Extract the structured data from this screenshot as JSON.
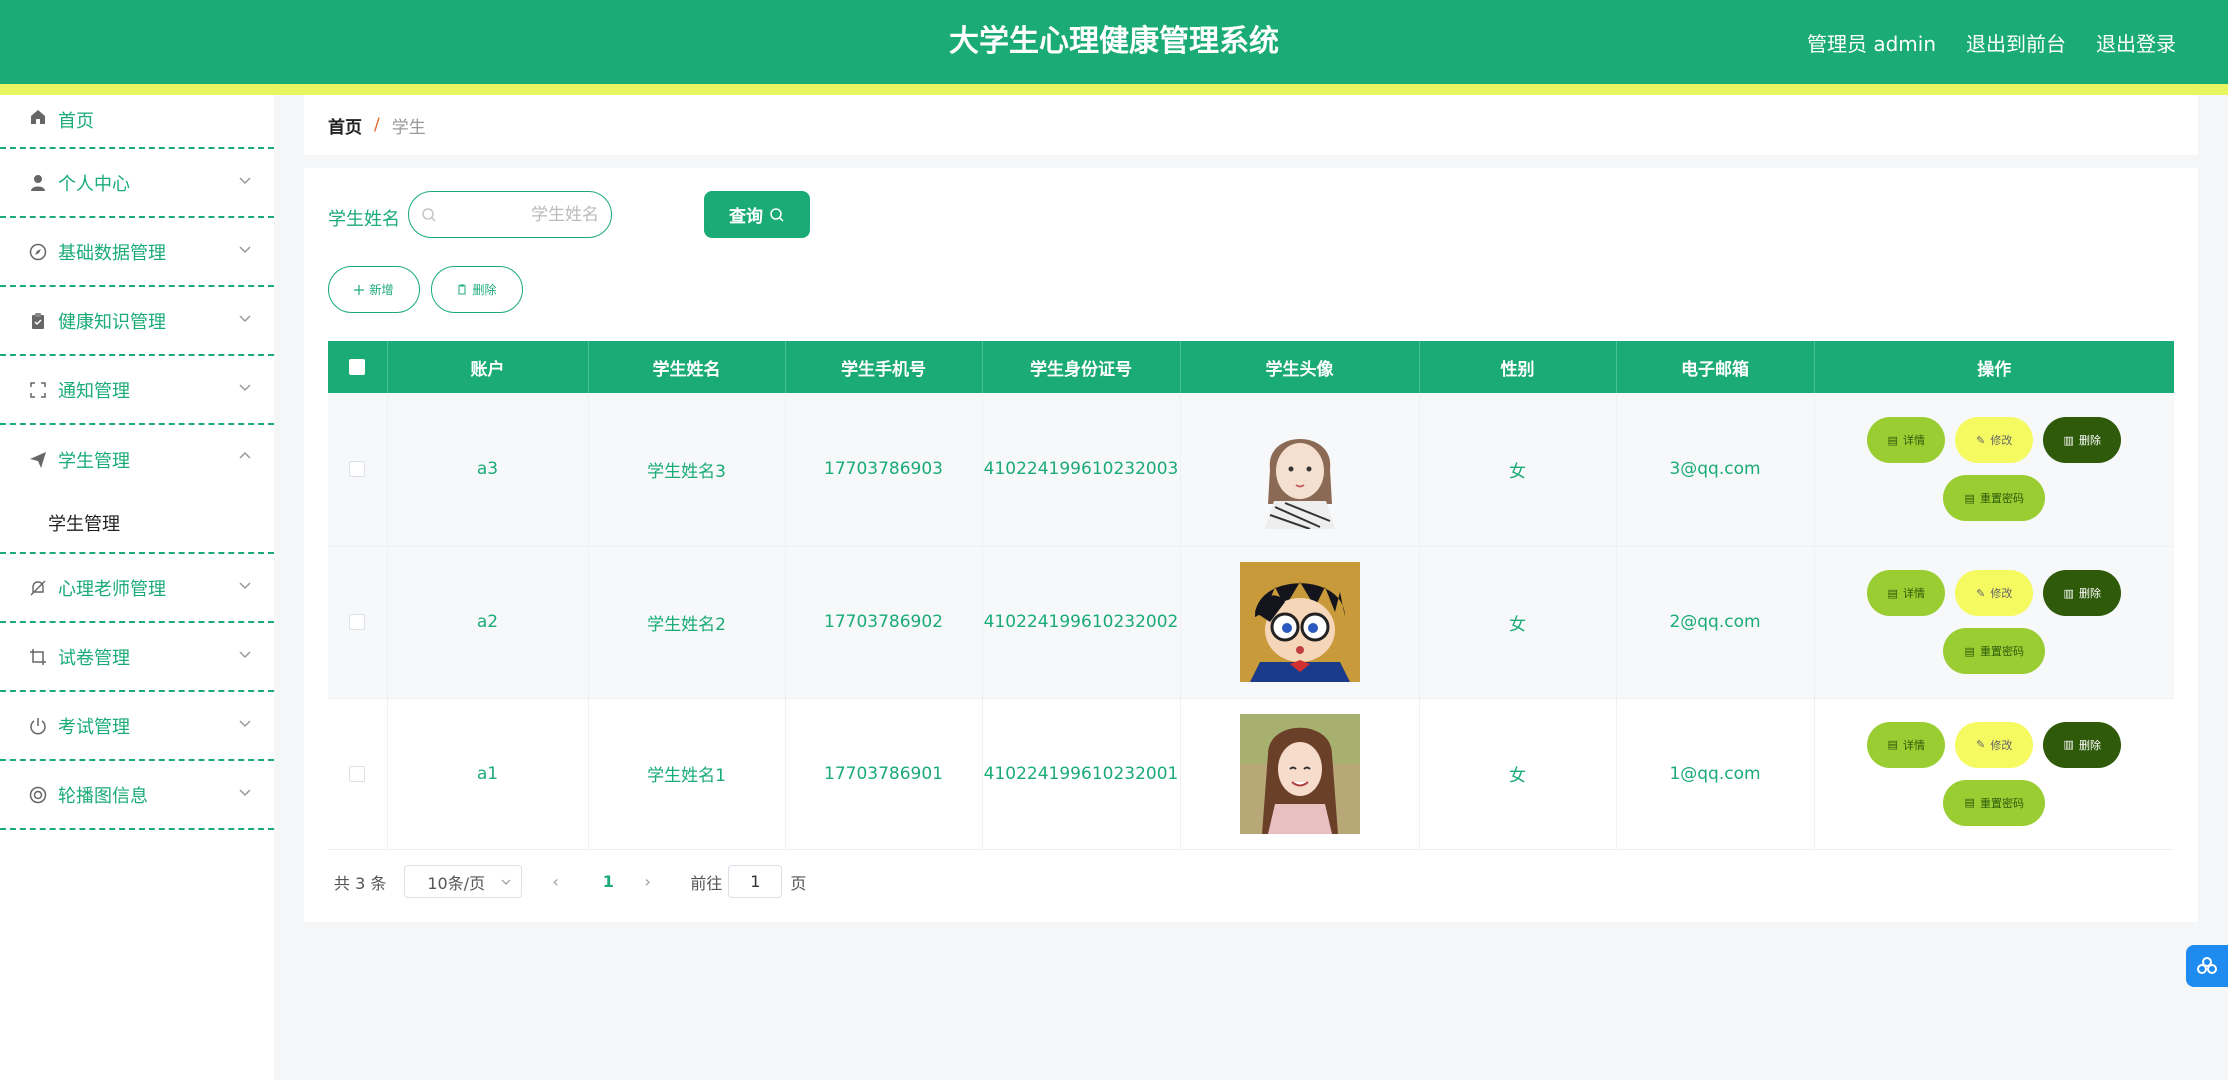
{
  "header": {
    "title": "大学生心理健康管理系统",
    "admin": "管理员 admin",
    "to_front": "退出到前台",
    "logout": "退出登录"
  },
  "sidebar": {
    "items": [
      {
        "label": "首页",
        "icon": "home-icon"
      },
      {
        "label": "个人中心",
        "icon": "user-icon"
      },
      {
        "label": "基础数据管理",
        "icon": "compass-icon"
      },
      {
        "label": "健康知识管理",
        "icon": "clipboard-icon"
      },
      {
        "label": "通知管理",
        "icon": "frame-icon"
      },
      {
        "label": "学生管理",
        "icon": "send-icon"
      },
      {
        "label": "心理老师管理",
        "icon": "bell-off-icon"
      },
      {
        "label": "试卷管理",
        "icon": "crop-icon"
      },
      {
        "label": "考试管理",
        "icon": "power-icon"
      },
      {
        "label": "轮播图信息",
        "icon": "lifebuoy-icon"
      }
    ],
    "sub_item": "学生管理"
  },
  "breadcrumb": {
    "home": "首页",
    "sep": "/",
    "current": "学生"
  },
  "search": {
    "label": "学生姓名",
    "placeholder": "学生姓名",
    "button": "查询"
  },
  "actions": {
    "add": "新增",
    "delete": "删除"
  },
  "table": {
    "headers": [
      "账户",
      "学生姓名",
      "学生手机号",
      "学生身份证号",
      "学生头像",
      "性别",
      "电子邮箱",
      "操作"
    ],
    "rows": [
      {
        "account": "a3",
        "name": "学生姓名3",
        "phone": "17703786903",
        "id_card": "410224199610232003",
        "gender": "女",
        "email": "3@qq.com"
      },
      {
        "account": "a2",
        "name": "学生姓名2",
        "phone": "17703786902",
        "id_card": "410224199610232002",
        "gender": "女",
        "email": "2@qq.com"
      },
      {
        "account": "a1",
        "name": "学生姓名1",
        "phone": "17703786901",
        "id_card": "410224199610232001",
        "gender": "女",
        "email": "1@qq.com"
      }
    ],
    "ops": {
      "detail": "详情",
      "edit": "修改",
      "delete": "删除",
      "reset": "重置密码"
    }
  },
  "pager": {
    "total": "共 3 条",
    "size": "10条/页",
    "current": "1",
    "goto": "前往",
    "page_value": "1",
    "unit": "页"
  },
  "colors": {
    "primary": "#1aab77",
    "stripe": "#e9f55e",
    "detail_bg": "#9acd32",
    "edit_bg": "#f5fa60",
    "delete_bg": "#2e5a0a"
  }
}
